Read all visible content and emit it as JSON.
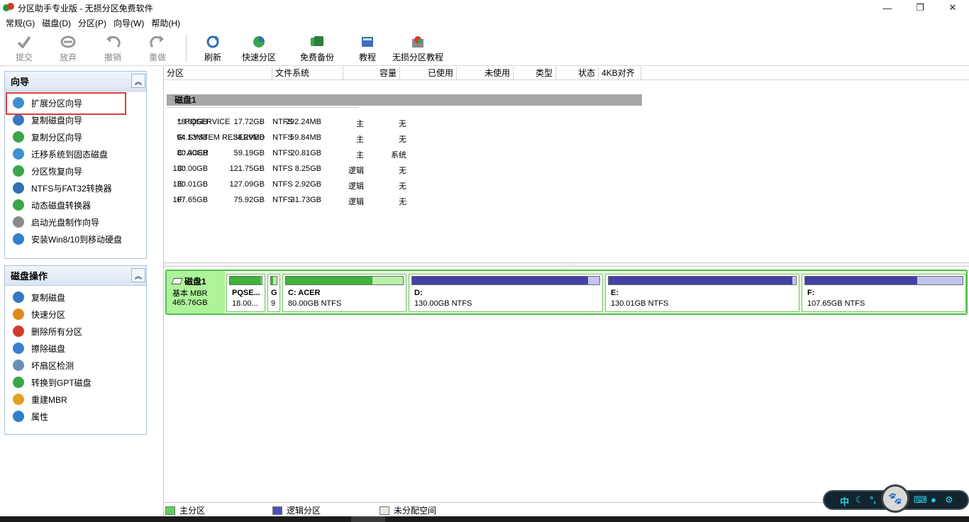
{
  "window": {
    "title": "分区助手专业版 - 无损分区免费软件",
    "controls": {
      "minimize": "—",
      "maximize": "❐",
      "close": "✕"
    }
  },
  "menu": [
    "常规(G)",
    "磁盘(D)",
    "分区(P)",
    "向导(W)",
    "帮助(H)"
  ],
  "toolbar": {
    "commit": "提交",
    "discard": "放弃",
    "undo": "撤销",
    "redo": "重做",
    "refresh": "刷新",
    "quick_partition": "快速分区",
    "free_backup": "免费备份",
    "tutorial": "教程",
    "lossless_tutorial": "无损分区教程"
  },
  "wizard_panel": {
    "title": "向导",
    "items": [
      {
        "label": "扩展分区向导",
        "icon": "extend-partition-icon",
        "color": "#3f8fd0"
      },
      {
        "label": "复制磁盘向导",
        "icon": "copy-disk-icon",
        "color": "#3577c2"
      },
      {
        "label": "复制分区向导",
        "icon": "copy-partition-icon",
        "color": "#3aa54a"
      },
      {
        "label": "迁移系统到固态磁盘",
        "icon": "migrate-ssd-icon",
        "color": "#3f8fd0"
      },
      {
        "label": "分区恢复向导",
        "icon": "recovery-icon",
        "color": "#3aa54a"
      },
      {
        "label": "NTFS与FAT32转换器",
        "icon": "ntfs-fat32-icon",
        "color": "#2f6fb5"
      },
      {
        "label": "动态磁盘转换器",
        "icon": "dynamic-disk-icon",
        "color": "#3aa54a"
      },
      {
        "label": "启动光盘制作向导",
        "icon": "boot-cd-icon",
        "color": "#8a8a8a"
      },
      {
        "label": "安装Win8/10到移动硬盘",
        "icon": "windows-usb-icon",
        "color": "#2f7fcf"
      }
    ]
  },
  "disk_ops_panel": {
    "title": "磁盘操作",
    "items": [
      {
        "label": "复制磁盘",
        "icon": "copy-disk-icon",
        "color": "#3577c2"
      },
      {
        "label": "快速分区",
        "icon": "quick-partition-icon",
        "color": "#e08a1e"
      },
      {
        "label": "删除所有分区",
        "icon": "delete-all-icon",
        "color": "#d23b2a"
      },
      {
        "label": "擦除磁盘",
        "icon": "wipe-disk-icon",
        "color": "#3a7fd0"
      },
      {
        "label": "坏扇区检测",
        "icon": "bad-sector-icon",
        "color": "#6a8fb5"
      },
      {
        "label": "转换到GPT磁盘",
        "icon": "convert-gpt-icon",
        "color": "#3aa54a"
      },
      {
        "label": "重建MBR",
        "icon": "rebuild-mbr-icon",
        "color": "#e0a21e"
      },
      {
        "label": "属性",
        "icon": "info-icon",
        "color": "#2f7fcf"
      }
    ]
  },
  "table": {
    "headers": [
      "分区",
      "文件系统",
      "容量",
      "已使用",
      "未使用",
      "类型",
      "状态",
      "4KB对齐"
    ],
    "disk_label": "磁盘1",
    "rows": [
      {
        "partition": "*: PQSERVICE",
        "fs": "NTFS",
        "capacity": "18.00GB",
        "used": "17.72GB",
        "free": "292.24MB",
        "type": "主",
        "status": "无"
      },
      {
        "partition": "G: SYSTEM RESERVED",
        "fs": "NTFS",
        "capacity": "94.13MB",
        "used": "34.29MB",
        "free": "59.84MB",
        "type": "主",
        "status": "无"
      },
      {
        "partition": "C: ACER",
        "fs": "NTFS",
        "capacity": "80.00GB",
        "used": "59.19GB",
        "free": "20.81GB",
        "type": "主",
        "status": "系统"
      },
      {
        "partition": "D:",
        "fs": "NTFS",
        "capacity": "130.00GB",
        "used": "121.75GB",
        "free": "8.25GB",
        "type": "逻辑",
        "status": "无"
      },
      {
        "partition": "E:",
        "fs": "NTFS",
        "capacity": "130.01GB",
        "used": "127.09GB",
        "free": "2.92GB",
        "type": "逻辑",
        "status": "无"
      },
      {
        "partition": "F:",
        "fs": "NTFS",
        "capacity": "107.65GB",
        "used": "75.92GB",
        "free": "31.73GB",
        "type": "逻辑",
        "status": "无"
      }
    ]
  },
  "diskmap": {
    "name": "磁盘1",
    "type": "基本 MBR",
    "size": "465.76GB",
    "partitions": [
      {
        "name": "PQSE...",
        "size": "18.00...",
        "used_fraction": 0.98,
        "kind": "primary"
      },
      {
        "name": "G",
        "size": "9",
        "used_fraction": 0.36,
        "kind": "primary"
      },
      {
        "name": "C: ACER",
        "size": "80.00GB NTFS",
        "used_fraction": 0.74,
        "kind": "primary"
      },
      {
        "name": "D:",
        "size": "130.00GB NTFS",
        "used_fraction": 0.94,
        "kind": "logical"
      },
      {
        "name": "E:",
        "size": "130.01GB NTFS",
        "used_fraction": 0.98,
        "kind": "logical"
      },
      {
        "name": "F:",
        "size": "107.65GB NTFS",
        "used_fraction": 0.71,
        "kind": "logical"
      }
    ]
  },
  "legend": {
    "primary": "主分区",
    "logical": "逻辑分区",
    "unallocated": "未分配空间"
  },
  "widget": {
    "ime_label": "中"
  },
  "colors": {
    "primary_fill": "#3fb33a",
    "logical_fill": "#4141a6",
    "highlight": "#e03a3a",
    "diskmap_border": "#4fbf49"
  }
}
